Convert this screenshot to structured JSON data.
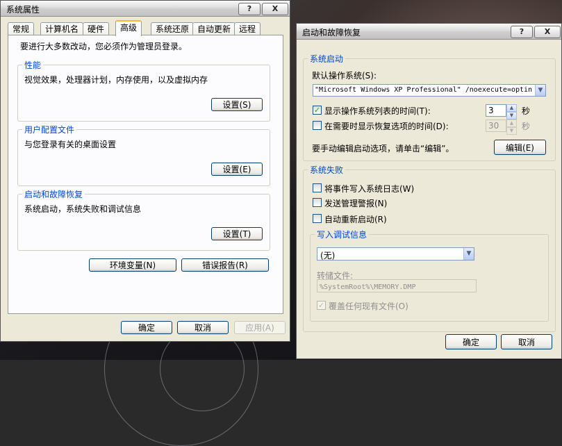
{
  "system_properties": {
    "title": "系统属性",
    "help_button": "?",
    "close_button": "X",
    "tabs": [
      {
        "label": "常规"
      },
      {
        "label": "计算机名"
      },
      {
        "label": "硬件"
      },
      {
        "label": "高级"
      },
      {
        "label": "系统还原"
      },
      {
        "label": "自动更新"
      },
      {
        "label": "远程"
      }
    ],
    "active_tab": "高级",
    "admin_notice": "要进行大多数改动，您必须作为管理员登录。",
    "performance": {
      "label": "性能",
      "description": "视觉效果，处理器计划，内存使用，以及虚拟内存",
      "button": "设置(S)"
    },
    "user_profiles": {
      "label": "用户配置文件",
      "description": "与您登录有关的桌面设置",
      "button": "设置(E)"
    },
    "startup_recovery": {
      "label": "启动和故障恢复",
      "description": "系统启动，系统失败和调试信息",
      "button": "设置(T)"
    },
    "env_vars_button": "环境变量(N)",
    "error_report_button": "错误报告(R)",
    "ok_button": "确定",
    "cancel_button": "取消",
    "apply_button": "应用(A)"
  },
  "startup_dialog": {
    "title": "启动和故障恢复",
    "help_button": "?",
    "close_button": "X",
    "system_startup": {
      "label": "系统启动",
      "default_os_label": "默认操作系统(S):",
      "default_os_value": "\"Microsoft Windows XP Professional\" /noexecute=optin",
      "show_os_list_label": "显示操作系统列表的时间(T):",
      "show_os_list_checked": true,
      "show_os_list_value": "3",
      "seconds_label": "秒",
      "show_recovery_label": "在需要时显示恢复选项的时间(D):",
      "show_recovery_checked": false,
      "show_recovery_value": "30",
      "seconds_label_2": "秒",
      "edit_hint": "要手动编辑启动选项，请单击“编辑”。",
      "edit_button": "编辑(E)"
    },
    "system_failure": {
      "label": "系统失败",
      "write_event_log": "将事件写入系统日志(W)",
      "send_alert": "发送管理警报(N)",
      "auto_restart": "自动重新启动(R)",
      "debug_info": {
        "label": "写入调试信息",
        "selected": "(无)",
        "dump_file_label": "转储文件:",
        "dump_file_value": "%SystemRoot%\\MEMORY.DMP",
        "overwrite_label": "覆盖任何现有文件(O)",
        "overwrite_checked": true
      }
    },
    "ok_button": "确定",
    "cancel_button": "取消"
  },
  "check_mark": "✓"
}
